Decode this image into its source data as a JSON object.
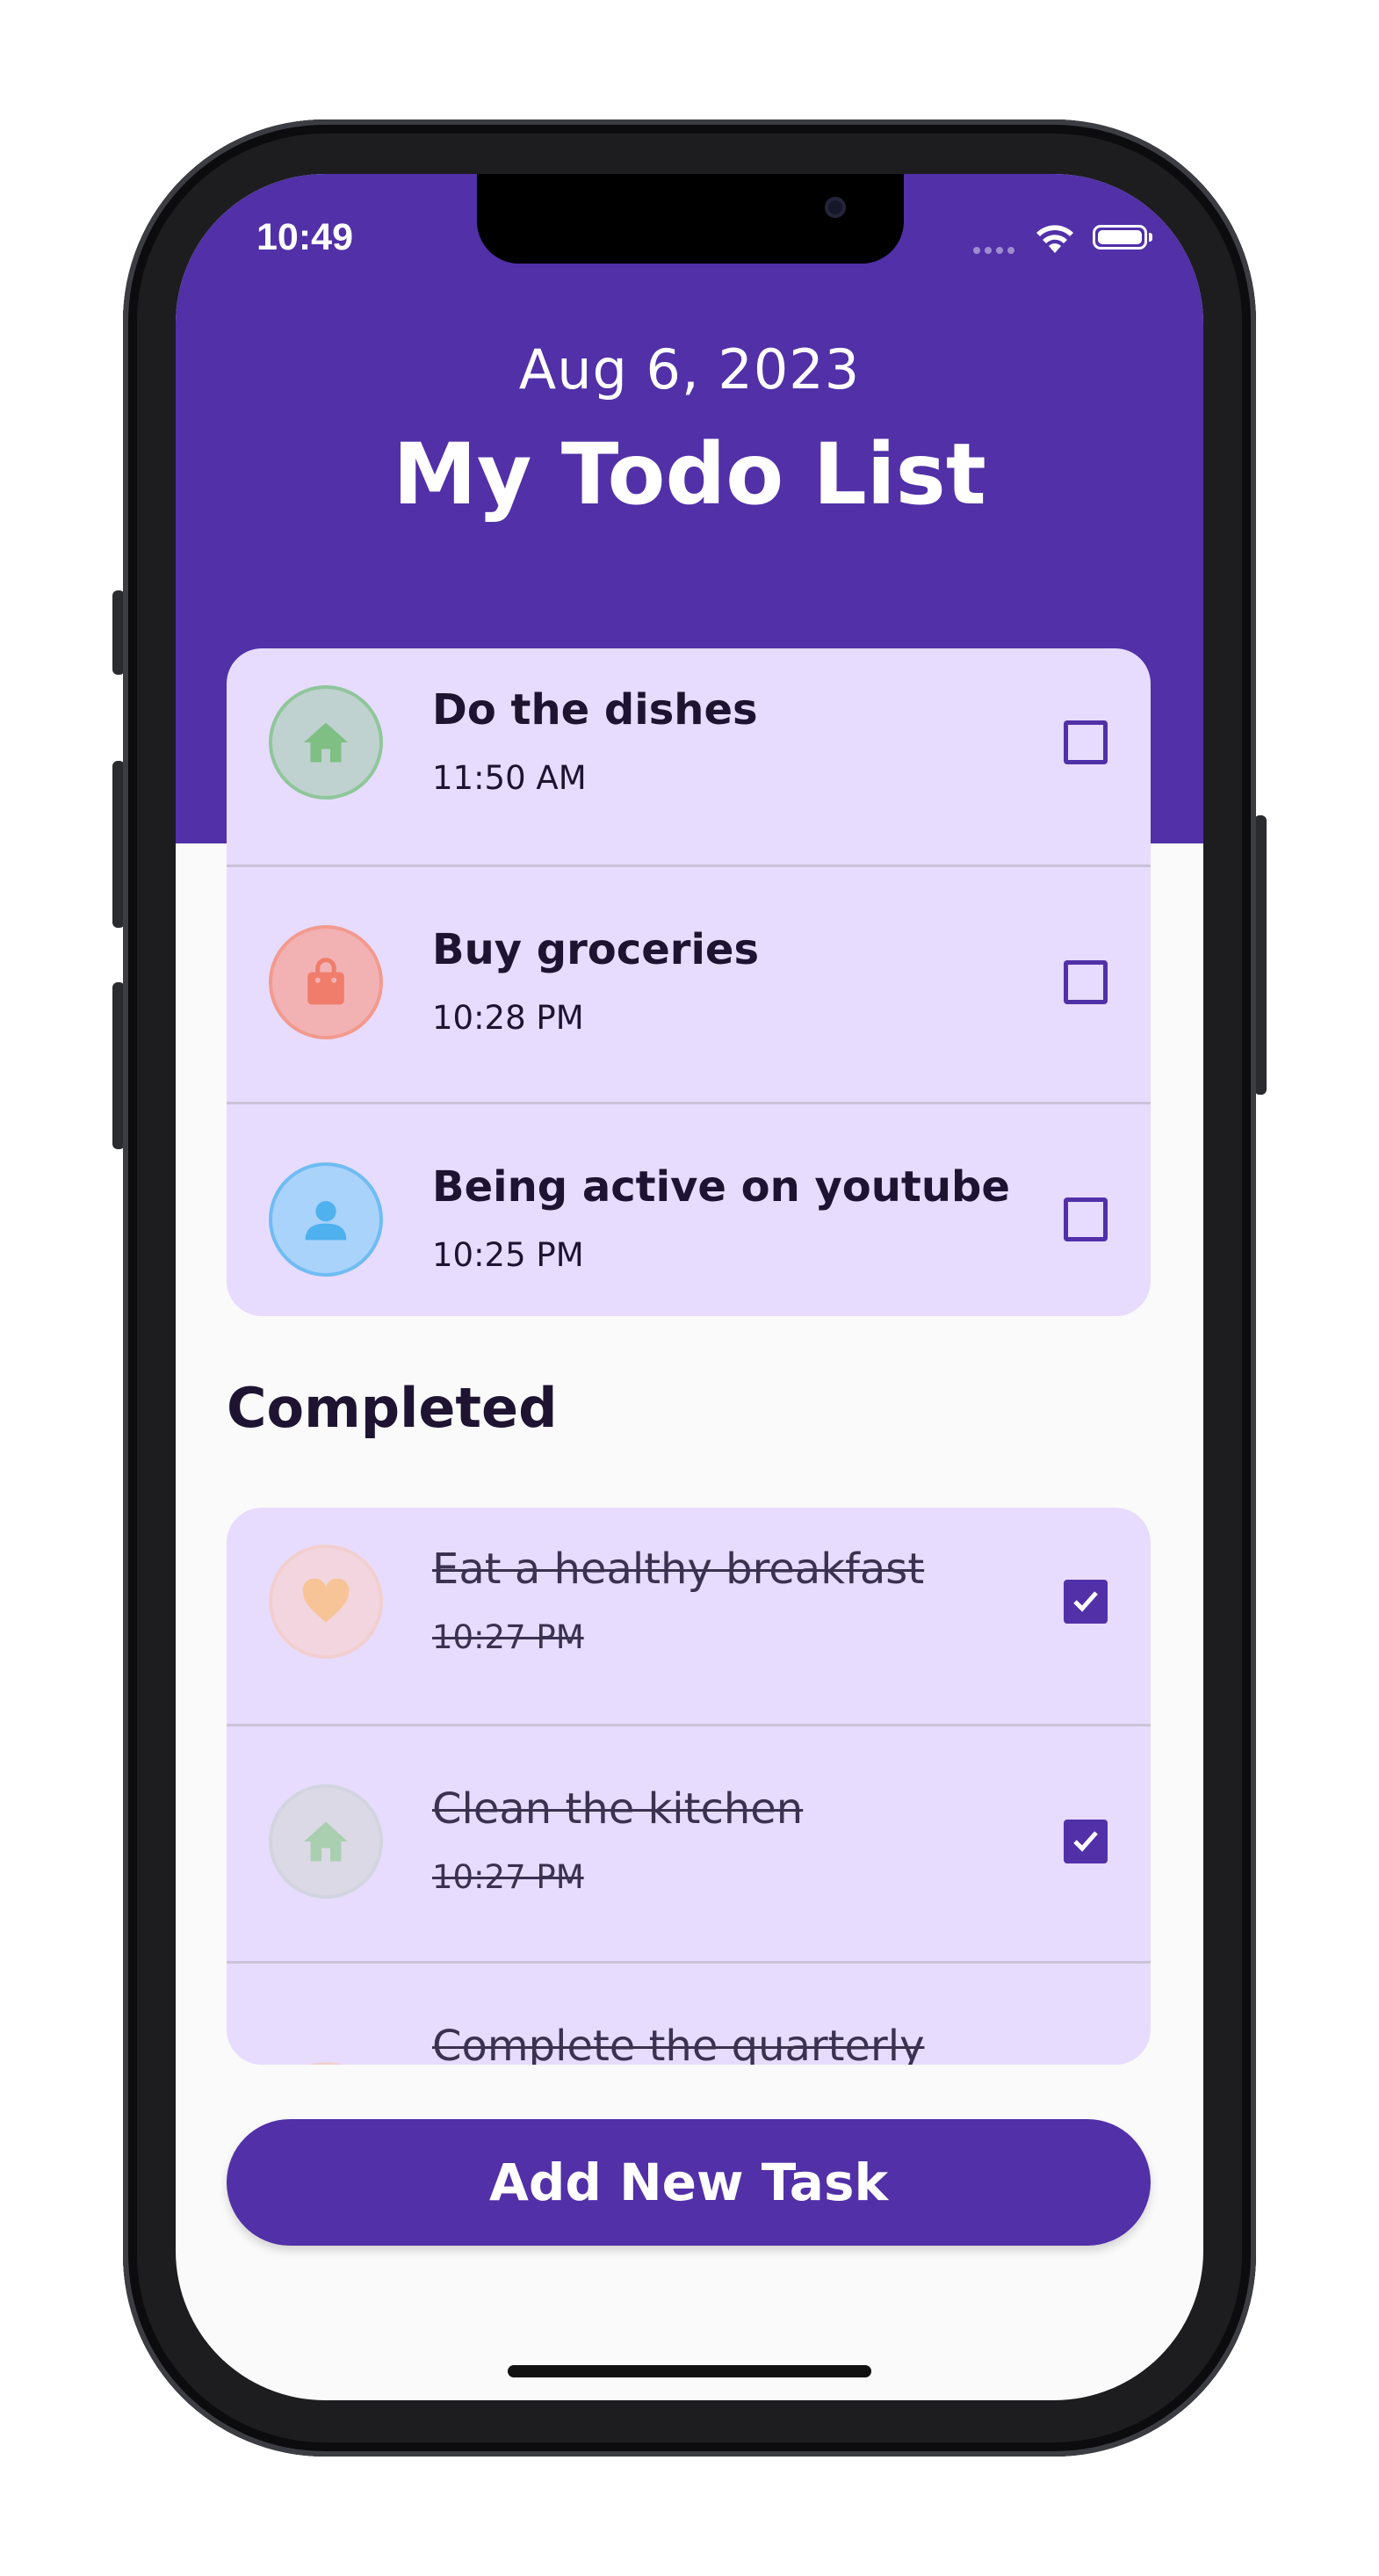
{
  "status_bar": {
    "time": "10:49"
  },
  "header": {
    "date": "Aug 6, 2023",
    "title": "My Todo List"
  },
  "colors": {
    "accent": "#5130a8",
    "card": "#e7dcfd",
    "text": "#1e1432"
  },
  "active_tasks": [
    {
      "title": "Do the dishes",
      "time": "11:50 AM",
      "icon": "home-icon",
      "checked": false,
      "icon_color": "#7fbf84",
      "circle_color": "#bfd2cf"
    },
    {
      "title": "Buy groceries",
      "time": "10:28 PM",
      "icon": "shopping-bag-icon",
      "checked": false,
      "icon_color": "#f07d6b",
      "circle_color": "#f2b2b4"
    },
    {
      "title": "Being active on youtube",
      "time": "10:25 PM",
      "icon": "person-icon",
      "checked": false,
      "icon_color": "#4fb1ee",
      "circle_color": "#a9d3fb"
    }
  ],
  "completed_section": {
    "title": "Completed"
  },
  "completed_tasks": [
    {
      "title": "Eat a healthy breakfast",
      "time": "10:27 PM",
      "icon": "heart-icon",
      "checked": true
    },
    {
      "title": "Clean the kitchen",
      "time": "10:27 PM",
      "icon": "home-icon",
      "checked": true
    },
    {
      "title": "Complete the quarterly",
      "icon": "partial-icon",
      "checked": true
    }
  ],
  "add_button": {
    "label": "Add New Task"
  }
}
